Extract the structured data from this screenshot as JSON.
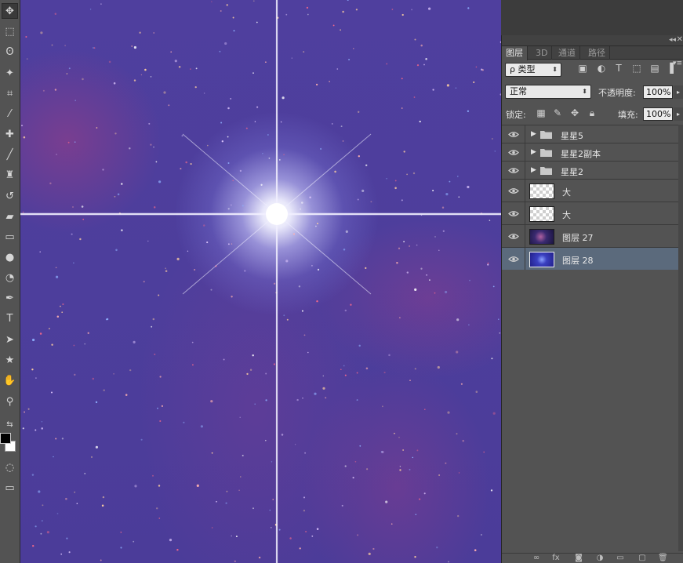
{
  "toolbar": {
    "tools": [
      {
        "name": "move-tool",
        "glyph": "✥"
      },
      {
        "name": "marquee-tool",
        "glyph": "⬚"
      },
      {
        "name": "lasso-tool",
        "glyph": "ʘ"
      },
      {
        "name": "magic-wand-tool",
        "glyph": "✦"
      },
      {
        "name": "crop-tool",
        "glyph": "⌗"
      },
      {
        "name": "eyedropper-tool",
        "glyph": "⁄"
      },
      {
        "name": "healing-brush-tool",
        "glyph": "✚"
      },
      {
        "name": "brush-tool",
        "glyph": "╱"
      },
      {
        "name": "clone-stamp-tool",
        "glyph": "♜"
      },
      {
        "name": "history-brush-tool",
        "glyph": "↺"
      },
      {
        "name": "eraser-tool",
        "glyph": "▰"
      },
      {
        "name": "gradient-tool",
        "glyph": "▭"
      },
      {
        "name": "blur-tool",
        "glyph": "●"
      },
      {
        "name": "dodge-tool",
        "glyph": "◔"
      },
      {
        "name": "pen-tool",
        "glyph": "✒"
      },
      {
        "name": "type-tool",
        "glyph": "T"
      },
      {
        "name": "path-selection-tool",
        "glyph": "➤"
      },
      {
        "name": "custom-shape-tool",
        "glyph": "★"
      },
      {
        "name": "hand-tool",
        "glyph": "✋"
      },
      {
        "name": "zoom-tool",
        "glyph": "⚲"
      }
    ],
    "swap_glyph": "⇆"
  },
  "panel": {
    "tabs": [
      "图层",
      "3D",
      "通道",
      "路径"
    ],
    "collapse_glyph": "◂◂",
    "close_glyph": "✕",
    "menu_glyph": "▾≡",
    "filter": {
      "label": "ρ 类型",
      "icons": [
        "image-filter-icon",
        "adjustment-filter-icon",
        "type-filter-icon",
        "shape-filter-icon",
        "smart-object-filter-icon"
      ]
    },
    "blend_mode": "正常",
    "opacity_label": "不透明度:",
    "opacity_value": "100%",
    "lock_label": "锁定:",
    "fill_label": "填充:",
    "fill_value": "100%",
    "layers": [
      {
        "name": "星星5",
        "kind": "group",
        "selected": false
      },
      {
        "name": "星星2副本",
        "kind": "group",
        "selected": false
      },
      {
        "name": "星星2",
        "kind": "group",
        "selected": false
      },
      {
        "name": "大",
        "kind": "transparent",
        "selected": false
      },
      {
        "name": "大",
        "kind": "transparent",
        "selected": false
      },
      {
        "name": "图层 27",
        "kind": "image27",
        "selected": false
      },
      {
        "name": "图层 28",
        "kind": "image28",
        "selected": true
      }
    ],
    "bottom_icons": [
      "link-layers-icon",
      "fx-icon",
      "mask-icon",
      "adjustment-layer-icon",
      "new-group-icon",
      "new-layer-icon",
      "delete-layer-icon"
    ],
    "bottom_glyphs": [
      "∞",
      "fx",
      "◙",
      "◑",
      "▭",
      "▢",
      "🗑"
    ]
  },
  "colors": {
    "canvas_base": "#4d3e9c",
    "panel_bg": "#535353",
    "selected_layer": "#5b6a7c"
  }
}
